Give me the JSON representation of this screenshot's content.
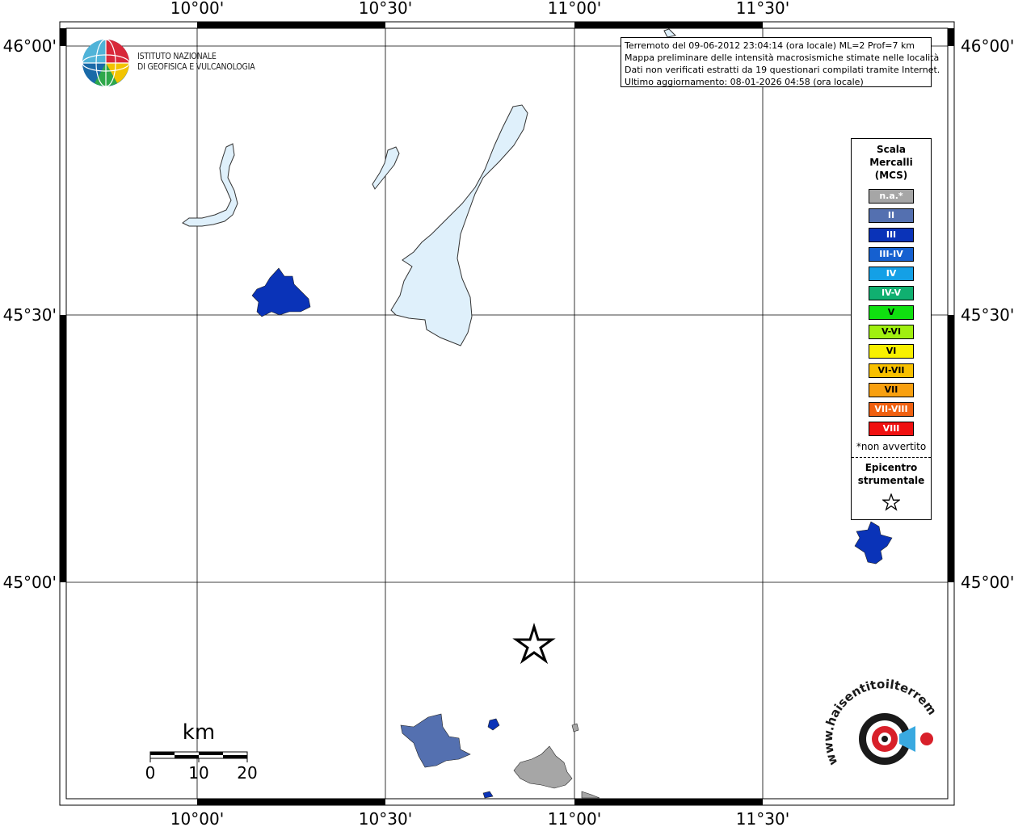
{
  "map": {
    "top_lon_labels": [
      "10°00'",
      "10°30'",
      "11°00'",
      "11°30'"
    ],
    "bottom_lon_labels": [
      "10°00'",
      "10°30'",
      "11°00'",
      "11°30'"
    ],
    "left_lat_labels": [
      "46°00'",
      "45°30'",
      "45°00'"
    ],
    "right_lat_labels": [
      "46°00'",
      "45°30'",
      "45°00'"
    ]
  },
  "logo": {
    "line1": "ISTITUTO NAZIONALE",
    "line2": "DI GEOFISICA E VULCANOLOGIA"
  },
  "info": {
    "line1": "Terremoto del 09-06-2012 23:04:14 (ora locale) ML=2 Prof=7 km",
    "line2": "Mappa preliminare delle intensità macrosismiche stimate nelle località",
    "line3": "Dati non verificati estratti da 19 questionari compilati tramite Internet.",
    "line4": "Ultimo aggiornamento: 08-01-2026 04:58 (ora locale)"
  },
  "legend": {
    "title1": "Scala",
    "title2": "Mercalli",
    "title3": "(MCS)",
    "items": [
      {
        "label": "n.a.*",
        "color": "#a6a6a6"
      },
      {
        "label": "II",
        "color": "#5470b0"
      },
      {
        "label": "III",
        "color": "#0a33b8"
      },
      {
        "label": "III-IV",
        "color": "#1560d0"
      },
      {
        "label": "IV",
        "color": "#14a0e6"
      },
      {
        "label": "IV-V",
        "color": "#10b070"
      },
      {
        "label": "V",
        "color": "#10e010"
      },
      {
        "label": "V-VI",
        "color": "#a0f010"
      },
      {
        "label": "VI",
        "color": "#f8f000"
      },
      {
        "label": "VI-VII",
        "color": "#f8c000"
      },
      {
        "label": "VII",
        "color": "#f8a010"
      },
      {
        "label": "VII-VIII",
        "color": "#f06010"
      },
      {
        "label": "VIII",
        "color": "#f01010"
      }
    ],
    "note": "*non avvertito",
    "epicentre1": "Epicentro",
    "epicentre2": "strumentale"
  },
  "scale": {
    "unit": "km",
    "tick0": "0",
    "tick10": "10",
    "tick20": "20"
  },
  "watermark": {
    "text": "www.haisentitoilterremoto.it"
  },
  "colors": {
    "lake": "#dff0fb",
    "intensity_III": "#0a33b8",
    "intensity_II": "#5470b0",
    "not_felt": "#a6a6a6"
  }
}
